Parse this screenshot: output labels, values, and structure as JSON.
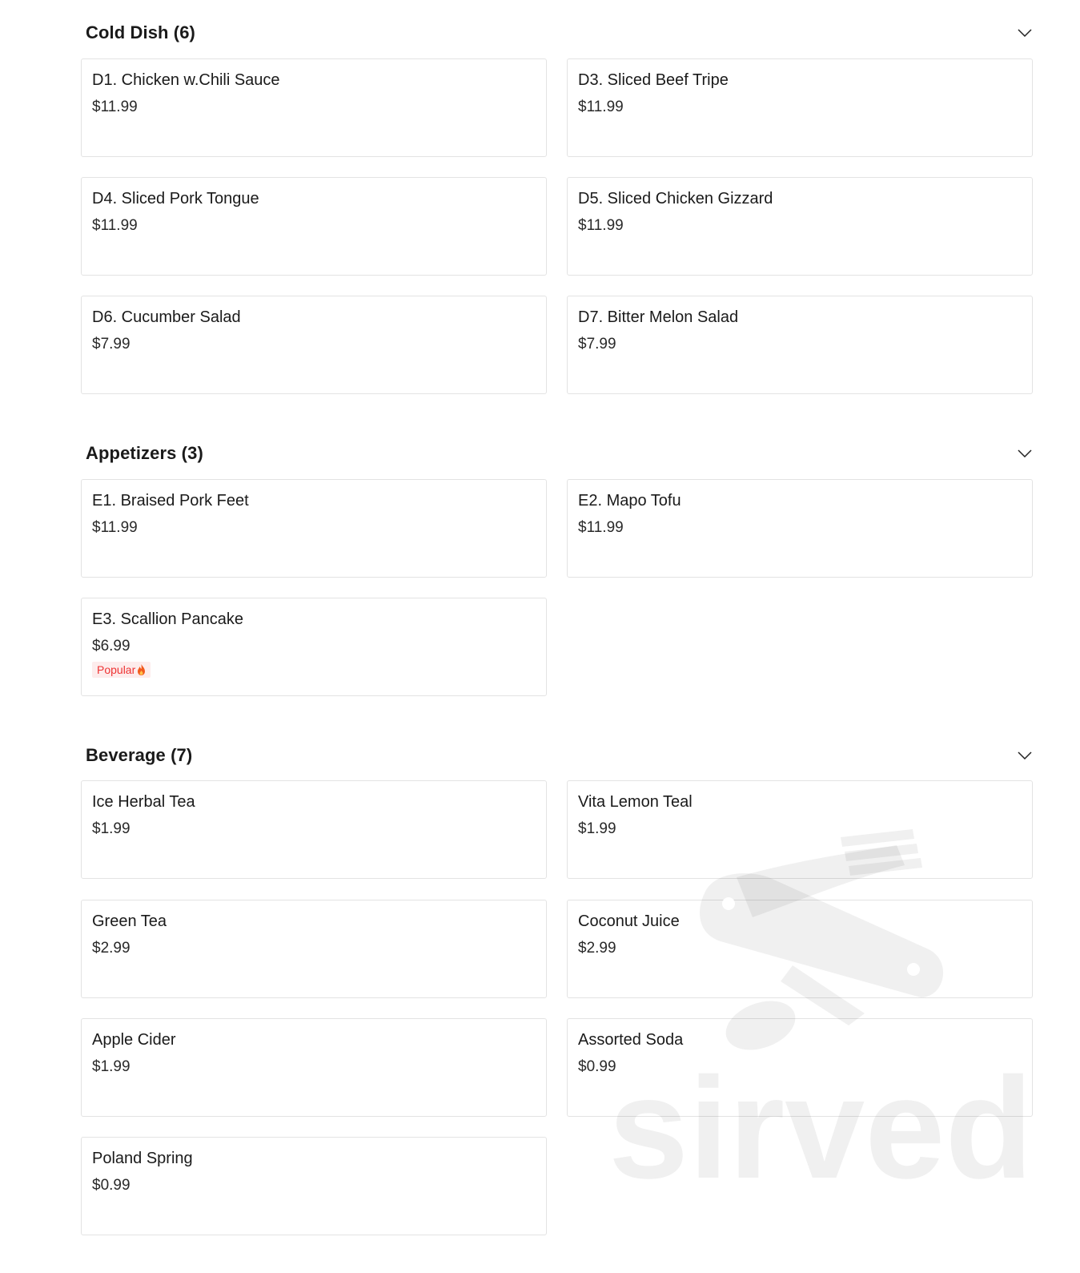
{
  "sections": [
    {
      "title": "Cold Dish (6)",
      "items": [
        {
          "name": "D1. Chicken w.Chili Sauce",
          "price": "$11.99"
        },
        {
          "name": "D3. Sliced Beef Tripe",
          "price": "$11.99"
        },
        {
          "name": "D4. Sliced Pork Tongue",
          "price": "$11.99"
        },
        {
          "name": "D5. Sliced Chicken Gizzard",
          "price": "$11.99"
        },
        {
          "name": "D6. Cucumber Salad",
          "price": "$7.99"
        },
        {
          "name": "D7. Bitter Melon Salad",
          "price": "$7.99"
        }
      ]
    },
    {
      "title": "Appetizers (3)",
      "items": [
        {
          "name": "E1. Braised Pork Feet",
          "price": "$11.99"
        },
        {
          "name": "E2. Mapo Tofu",
          "price": "$11.99"
        },
        {
          "name": "E3. Scallion Pancake",
          "price": "$6.99",
          "badge": "Popular"
        }
      ]
    },
    {
      "title": "Beverage (7)",
      "items": [
        {
          "name": "Ice Herbal Tea",
          "price": "$1.99"
        },
        {
          "name": "Vita Lemon Teal",
          "price": "$1.99"
        },
        {
          "name": "Green Tea",
          "price": "$2.99"
        },
        {
          "name": "Coconut Juice",
          "price": "$2.99"
        },
        {
          "name": "Apple Cider",
          "price": "$1.99"
        },
        {
          "name": "Assorted Soda",
          "price": "$0.99"
        },
        {
          "name": "Poland Spring",
          "price": "$0.99"
        }
      ]
    }
  ],
  "icons": {
    "section_toggle": "chevron-down-icon",
    "badge": "fire-icon"
  },
  "colors": {
    "badge_text": "#e33333",
    "badge_bg": "#fdecec",
    "card_border": "#e3e3e3"
  },
  "watermark": {
    "text": "sirved"
  }
}
